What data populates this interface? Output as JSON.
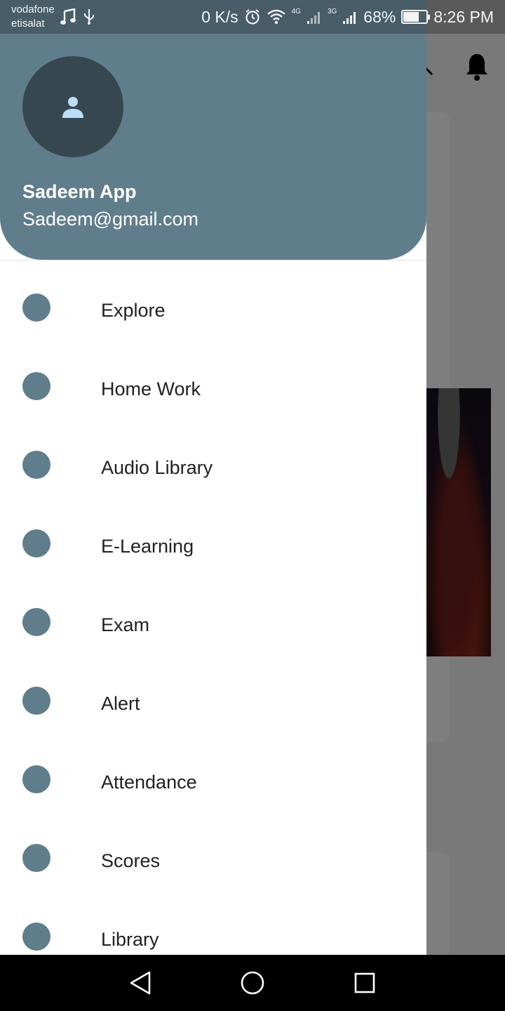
{
  "status_bar": {
    "carrier_line1": "vodafone",
    "carrier_line2": "etisalat",
    "speed": "0 K/s",
    "net1": "4G",
    "net2": "3G",
    "battery": "68%",
    "battery_level": 0.68,
    "time": "8:26 PM"
  },
  "drawer": {
    "user_name": "Sadeem App",
    "user_email": "Sadeem@gmail.com",
    "avatar_icon": "person-icon",
    "menu": [
      {
        "label": "Explore"
      },
      {
        "label": "Home Work"
      },
      {
        "label": "Audio Library"
      },
      {
        "label": "E-Learning"
      },
      {
        "label": "Exam"
      },
      {
        "label": "Alert"
      },
      {
        "label": "Attendance"
      },
      {
        "label": "Scores"
      },
      {
        "label": "Library"
      }
    ]
  },
  "colors": {
    "header": "#607d8b",
    "avatar_bg": "#37474f",
    "menu_dot": "#607d8b",
    "avatar_icon": "#bbdefb"
  },
  "nav_bar": {
    "back_icon": "back-triangle-icon",
    "home_icon": "home-circle-icon",
    "recents_icon": "recents-square-icon"
  }
}
